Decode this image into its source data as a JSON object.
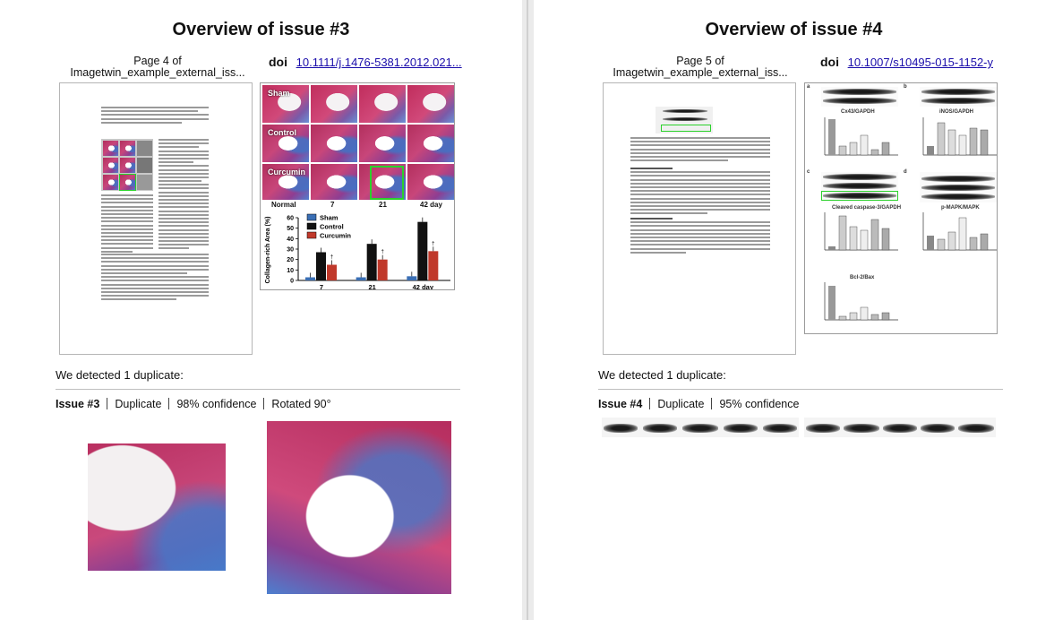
{
  "left": {
    "title": "Overview of issue #3",
    "page_label": "Page 4 of Imagetwin_example_external_iss...",
    "doi_label": "doi",
    "doi_value": "10.1111/j.1476-5381.2012.021...",
    "figure": {
      "rows": [
        "Sham",
        "Control",
        "Curcumin"
      ],
      "columns": [
        "Normal",
        "7",
        "21",
        "42 day"
      ],
      "chart_data": {
        "type": "bar",
        "categories": [
          "7",
          "21",
          "42 day"
        ],
        "ylabel": "Collagen-rich Area (%)",
        "ylim": [
          0,
          60
        ],
        "yticks": [
          "0",
          "10",
          "20",
          "30",
          "40",
          "50",
          "60"
        ],
        "series": [
          {
            "name": "Sham",
            "values": [
              3,
              3,
              4
            ],
            "color": "#3a6fb5"
          },
          {
            "name": "Control",
            "values": [
              27,
              35,
              56
            ],
            "color": "#111111"
          },
          {
            "name": "Curcumin",
            "values": [
              15,
              20,
              28
            ],
            "color": "#c0392b"
          }
        ],
        "annotations": [
          "†",
          "†",
          "†"
        ]
      }
    },
    "detected": "We detected 1 duplicate:",
    "meta": {
      "issue": "Issue #3",
      "type": "Duplicate",
      "confidence": "98% confidence",
      "transform": "Rotated 90°"
    }
  },
  "right": {
    "title": "Overview of issue #4",
    "page_label": "Page 5 of Imagetwin_example_external_iss...",
    "doi_label": "doi",
    "doi_value": "10.1007/s10495-015-1152-y",
    "figure": {
      "sections": [
        "a",
        "b",
        "c",
        "d"
      ],
      "panel_titles": [
        "Cx43/GAPDH",
        "iNOS/GAPDH",
        "Cleaved caspase-3/GAPDH",
        "p-MAPK/MAPK",
        "Bcl-2/Bax"
      ],
      "blot_labels": [
        "Cx43",
        "GAPDH",
        "iNOS",
        "p-MAPK",
        "MAPK"
      ]
    },
    "detected": "We detected 1 duplicate:",
    "meta": {
      "issue": "Issue #4",
      "type": "Duplicate",
      "confidence": "95% confidence"
    }
  },
  "colors": {
    "link": "#1a0dab",
    "highlight_green": "#2bd12b",
    "divider": "#ebebeb"
  }
}
